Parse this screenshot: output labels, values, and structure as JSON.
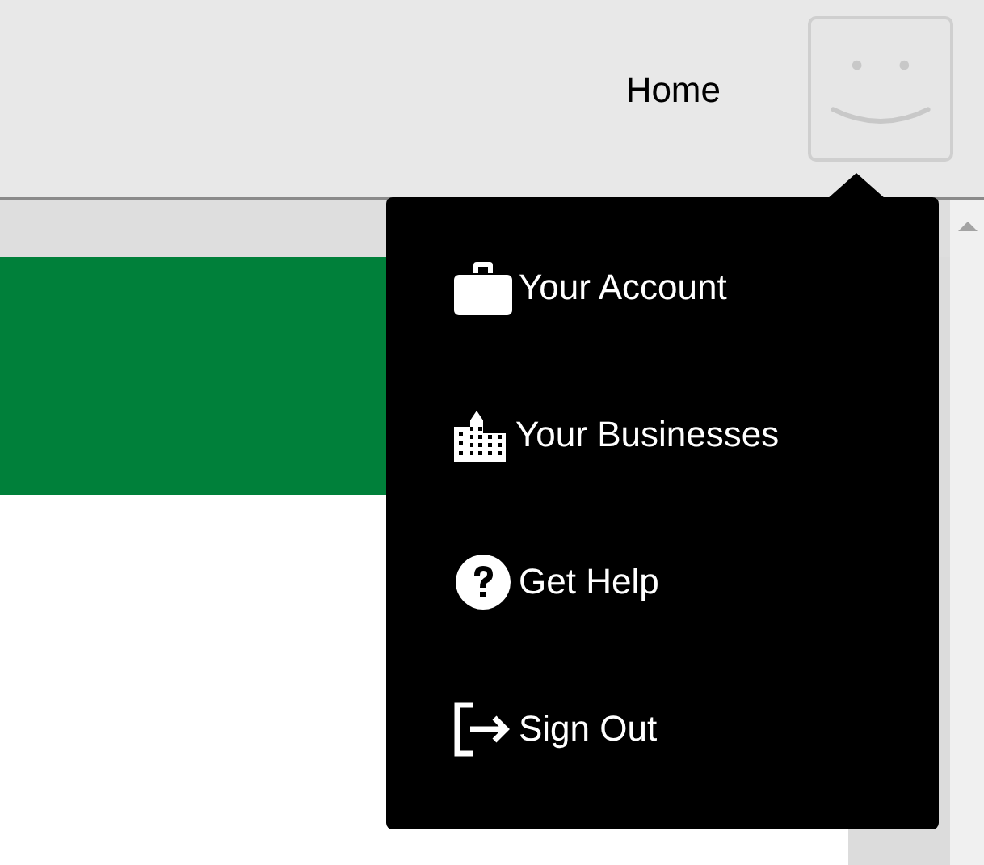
{
  "header": {
    "nav_link": "Home"
  },
  "account_menu": {
    "items": [
      {
        "kind": "briefcase",
        "label": "Your Account"
      },
      {
        "kind": "building",
        "label": "Your Businesses"
      },
      {
        "kind": "help",
        "label": "Get Help"
      },
      {
        "kind": "signout",
        "label": "Sign Out"
      }
    ]
  }
}
